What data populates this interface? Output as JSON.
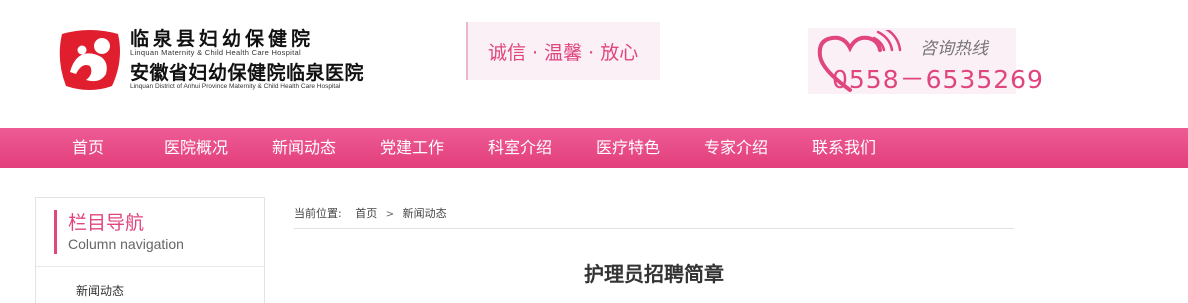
{
  "header": {
    "logo": {
      "name_cn": "临泉县妇幼保健院",
      "name_en": "Linquan Maternity & Child Health Care Hospital",
      "alt_name_cn": "安徽省妇幼保健院临泉医院",
      "alt_name_en": "Linquan District of Anhui Province Maternity & Child Health Care Hospital"
    },
    "slogan": "诚信 · 温馨 · 放心",
    "hotline": {
      "label": "咨询热线",
      "number": "0558－6535269"
    }
  },
  "nav": {
    "items": [
      {
        "label": "首页"
      },
      {
        "label": "医院概况"
      },
      {
        "label": "新闻动态"
      },
      {
        "label": "党建工作"
      },
      {
        "label": "科室介绍"
      },
      {
        "label": "医疗特色"
      },
      {
        "label": "专家介绍"
      },
      {
        "label": "联系我们"
      }
    ]
  },
  "sidebar": {
    "title": "栏目导航",
    "subtitle": "Column navigation",
    "items": [
      {
        "label": "新闻动态"
      }
    ]
  },
  "breadcrumb": {
    "label": "当前位置:",
    "items": [
      "首页",
      "新闻动态"
    ],
    "separator": ">"
  },
  "article": {
    "title": "护理员招聘简章"
  },
  "colors": {
    "accent": "#e0457e",
    "nav_bg": "#e23f7c",
    "logo_red": "#e01e2e"
  },
  "icons": {
    "logo": "mother-child-emblem-icon",
    "hotline": "heart-signal-icon"
  }
}
